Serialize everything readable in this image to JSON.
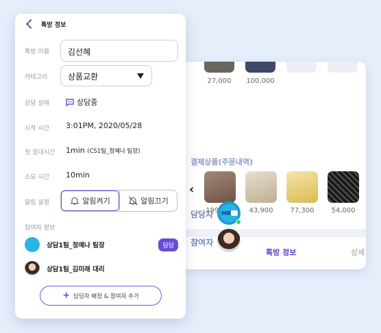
{
  "back_card": {
    "top_prices": [
      "27,000",
      "100,000"
    ],
    "section_title": "결제상품(주문내역)",
    "products": [
      {
        "price": "199,000",
        "color": "#8c6f5c"
      },
      {
        "price": "43,900",
        "color": "#cdbfa6"
      },
      {
        "price": "77,300",
        "color": "#e8d27a"
      },
      {
        "price": "54,000",
        "color": "#2a2a2a"
      }
    ],
    "tabs": {
      "active": "톡방 정보",
      "more": "상세"
    },
    "roles": {
      "manager": "담당자",
      "participant": "참여자"
    }
  },
  "panel": {
    "title": "톡방 정보",
    "labels": {
      "name": "톡방 이름",
      "category": "카테고리",
      "status": "상담 상태",
      "start": "시작 시간",
      "first_response": "첫 응대시간",
      "duration": "소요 시간",
      "alarm": "알림 설정"
    },
    "name_value": "김선혜",
    "category_value": "상품교환",
    "status_value": "상담중",
    "start_value": "3:01PM, 2020/05/28",
    "first_response_value": "1min",
    "first_response_detail": "(CS1팀_정예나 팀장)",
    "duration_value": "10min",
    "alarm_on": "알림켜기",
    "alarm_off": "알림끄기",
    "participants_title": "참여자 정보",
    "participants": [
      {
        "name": "상담1팀_정예나 팀장",
        "badge": "담당"
      },
      {
        "name": "상담1팀_김미래 대리"
      }
    ],
    "add_button": "담당자 배정 & 참여자 추가"
  },
  "colors": {
    "accent": "#6a4bd6",
    "label": "#7b84b5",
    "background": "#e6eefb"
  }
}
